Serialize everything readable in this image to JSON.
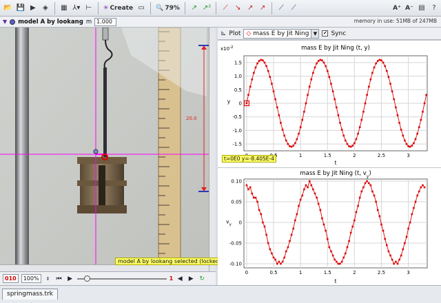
{
  "toolbar": {
    "create_label": "Create",
    "zoom_label": "79%"
  },
  "trackbar": {
    "track_name": "model A by lookang",
    "mass_label": "m",
    "mass_value": "1.000",
    "memory_text": "memory in use: 51MB of 247MB"
  },
  "video": {
    "calibration_value": "20.0",
    "lock_message": "model A by lookang selected (locked)"
  },
  "player": {
    "frame_value": "010",
    "rate_value": "100%",
    "end_frame": "1"
  },
  "plot": {
    "plot_label": "Plot",
    "track_select": "mass E by Jit Ning",
    "sync_label": "Sync",
    "readout": "t=0E0  y=-8.405E-4"
  },
  "status": {
    "file_tab": "springmass.trk"
  },
  "colors": {
    "marker": "#dd0000",
    "crosshair": "#ff00ff",
    "readout_bg": "#ffff66"
  },
  "chart_data": [
    {
      "type": "line",
      "title": "mass E by Jit Ning (t, y)",
      "xlabel": "t",
      "ylabel": "y",
      "yscale_label": "x10",
      "yscale_exp": "-2",
      "xlim": [
        -0.05,
        3.35
      ],
      "ylim": [
        -1.75,
        1.75
      ],
      "xticks": [
        "0",
        "0.5",
        "1",
        "1.5",
        "2",
        "2.5",
        "3"
      ],
      "xtick_values": [
        0,
        0.5,
        1,
        1.5,
        2,
        2.5,
        3
      ],
      "yticks": [
        "1.5",
        "1.0",
        "0.5",
        "0",
        "-0.5",
        "-1.0",
        "-1.5"
      ],
      "ytick_values": [
        1.5,
        1.0,
        0.5,
        0,
        -0.5,
        -1.0,
        -1.5
      ],
      "series": [
        {
          "x": [
            0,
            0.033,
            0.067,
            0.1,
            0.133,
            0.167,
            0.2,
            0.233,
            0.267,
            0.3,
            0.333,
            0.367,
            0.4,
            0.433,
            0.467,
            0.5,
            0.533,
            0.567,
            0.6,
            0.633,
            0.667,
            0.7,
            0.733,
            0.767,
            0.8,
            0.833,
            0.867,
            0.9,
            0.933,
            0.967,
            1,
            1.033,
            1.067,
            1.1,
            1.133,
            1.167,
            1.2,
            1.233,
            1.267,
            1.3,
            1.333,
            1.367,
            1.4,
            1.433,
            1.467,
            1.5,
            1.533,
            1.567,
            1.6,
            1.633,
            1.667,
            1.7,
            1.733,
            1.767,
            1.8,
            1.833,
            1.867,
            1.9,
            1.933,
            1.967,
            2,
            2.033,
            2.067,
            2.1,
            2.133,
            2.167,
            2.2,
            2.233,
            2.267,
            2.3,
            2.333,
            2.367,
            2.4,
            2.433,
            2.467,
            2.5,
            2.533,
            2.567,
            2.6,
            2.633,
            2.667,
            2.7,
            2.733,
            2.767,
            2.8,
            2.833,
            2.867,
            2.9,
            2.933,
            2.967,
            3,
            3.033,
            3.067,
            3.1,
            3.133,
            3.167,
            3.2,
            3.233,
            3.267,
            3.3,
            3.333
          ],
          "values": [
            0,
            0.31,
            0.61,
            0.88,
            1.12,
            1.32,
            1.47,
            1.56,
            1.6,
            1.58,
            1.5,
            1.37,
            1.19,
            0.97,
            0.72,
            0.44,
            0.15,
            -0.15,
            -0.44,
            -0.72,
            -0.97,
            -1.19,
            -1.37,
            -1.5,
            -1.58,
            -1.6,
            -1.56,
            -1.47,
            -1.32,
            -1.12,
            -0.88,
            -0.61,
            -0.31,
            0,
            0.31,
            0.61,
            0.88,
            1.12,
            1.32,
            1.47,
            1.56,
            1.6,
            1.58,
            1.5,
            1.37,
            1.19,
            0.97,
            0.72,
            0.44,
            0.15,
            -0.15,
            -0.44,
            -0.72,
            -0.97,
            -1.19,
            -1.37,
            -1.5,
            -1.58,
            -1.6,
            -1.56,
            -1.47,
            -1.32,
            -1.12,
            -0.88,
            -0.61,
            -0.31,
            0,
            0.31,
            0.61,
            0.88,
            1.12,
            1.32,
            1.47,
            1.56,
            1.6,
            1.58,
            1.5,
            1.37,
            1.19,
            0.97,
            0.72,
            0.44,
            0.15,
            -0.15,
            -0.44,
            -0.72,
            -0.97,
            -1.19,
            -1.37,
            -1.5,
            -1.58,
            -1.6,
            -1.56,
            -1.47,
            -1.32,
            -1.12,
            -0.88,
            -0.61,
            -0.31,
            0,
            0.31
          ]
        }
      ],
      "grid": true
    },
    {
      "type": "line",
      "title": "mass E by Jit Ning (t, v",
      "title_sub": "y",
      "title_close": ")",
      "xlabel": "t",
      "ylabel": "v",
      "ylabel_sub": "y",
      "xlim": [
        -0.05,
        3.35
      ],
      "ylim": [
        -0.11,
        0.105
      ],
      "xticks": [
        "0",
        "0.5",
        "1",
        "1.5",
        "2",
        "2.5",
        "3"
      ],
      "xtick_values": [
        0,
        0.5,
        1,
        1.5,
        2,
        2.5,
        3
      ],
      "yticks": [
        "0.10",
        "0.05",
        "0",
        "-0.05",
        "-0.10"
      ],
      "ytick_values": [
        0.1,
        0.05,
        0,
        -0.05,
        -0.1
      ],
      "series": [
        {
          "x": [
            0,
            0.033,
            0.067,
            0.1,
            0.133,
            0.167,
            0.2,
            0.233,
            0.267,
            0.3,
            0.333,
            0.367,
            0.4,
            0.433,
            0.467,
            0.5,
            0.533,
            0.567,
            0.6,
            0.633,
            0.667,
            0.7,
            0.733,
            0.767,
            0.8,
            0.833,
            0.867,
            0.9,
            0.933,
            0.967,
            1,
            1.033,
            1.067,
            1.1,
            1.133,
            1.167,
            1.2,
            1.233,
            1.267,
            1.3,
            1.333,
            1.367,
            1.4,
            1.433,
            1.467,
            1.5,
            1.533,
            1.567,
            1.6,
            1.633,
            1.667,
            1.7,
            1.733,
            1.767,
            1.8,
            1.833,
            1.867,
            1.9,
            1.933,
            1.967,
            2,
            2.033,
            2.067,
            2.1,
            2.133,
            2.167,
            2.2,
            2.233,
            2.267,
            2.3,
            2.333,
            2.367,
            2.4,
            2.433,
            2.467,
            2.5,
            2.533,
            2.567,
            2.6,
            2.633,
            2.667,
            2.7,
            2.733,
            2.767,
            2.8,
            2.833,
            2.867,
            2.9,
            2.933,
            2.967,
            3,
            3.033,
            3.067,
            3.1,
            3.133,
            3.167,
            3.2,
            3.233,
            3.267,
            3.3
          ],
          "values": [
            0.09,
            0.08,
            0.085,
            0.07,
            0.06,
            0.06,
            0.05,
            0.03,
            0.02,
            0.0,
            -0.01,
            -0.03,
            -0.05,
            -0.065,
            -0.075,
            -0.085,
            -0.09,
            -0.1,
            -0.095,
            -0.1,
            -0.095,
            -0.085,
            -0.07,
            -0.06,
            -0.045,
            -0.03,
            -0.015,
            0.005,
            0.02,
            0.04,
            0.055,
            0.065,
            0.08,
            0.09,
            0.085,
            0.1,
            0.09,
            0.08,
            0.07,
            0.06,
            0.045,
            0.03,
            0.01,
            -0.005,
            -0.02,
            -0.04,
            -0.06,
            -0.07,
            -0.08,
            -0.09,
            -0.095,
            -0.1,
            -0.1,
            -0.095,
            -0.085,
            -0.075,
            -0.06,
            -0.045,
            -0.025,
            -0.01,
            0.005,
            0.025,
            0.04,
            0.06,
            0.075,
            0.085,
            0.095,
            0.1,
            0.095,
            0.09,
            0.075,
            0.065,
            0.05,
            0.03,
            0.015,
            -0.005,
            -0.02,
            -0.04,
            -0.055,
            -0.07,
            -0.08,
            -0.09,
            -0.1,
            -0.095,
            -0.1,
            -0.09,
            -0.08,
            -0.065,
            -0.05,
            -0.035,
            -0.015,
            0.0,
            0.02,
            0.035,
            0.05,
            0.065,
            0.075,
            0.085,
            0.09,
            0.085
          ]
        }
      ],
      "grid": true
    }
  ]
}
